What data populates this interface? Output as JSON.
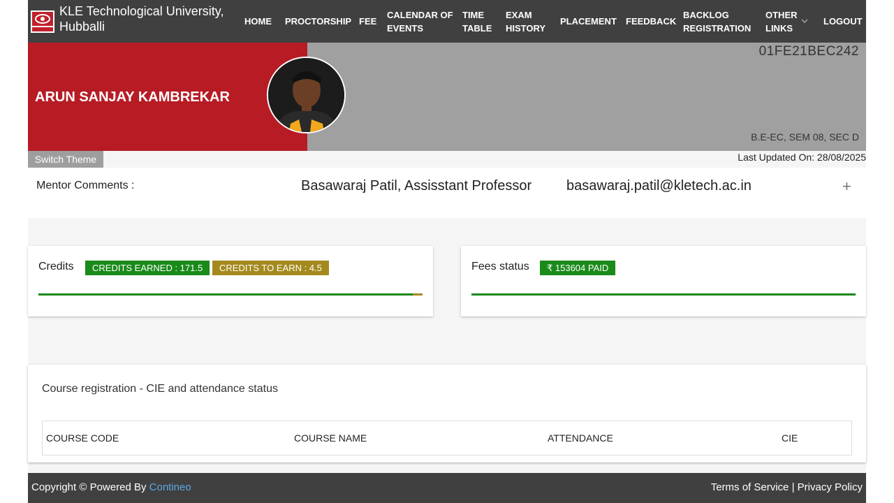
{
  "navbar": {
    "brand_line1": "KLE Technological University,",
    "brand_line2": "Hubballi",
    "logo_text": "KLE TECH",
    "items": [
      {
        "l1": "HOME",
        "l2": ""
      },
      {
        "l1": "PROCTORSHIP",
        "l2": ""
      },
      {
        "l1": "FEE",
        "l2": ""
      },
      {
        "l1": "CALENDAR OF",
        "l2": "EVENTS"
      },
      {
        "l1": "TIME",
        "l2": "TABLE"
      },
      {
        "l1": "EXAM",
        "l2": "HISTORY"
      },
      {
        "l1": "PLACEMENT",
        "l2": ""
      },
      {
        "l1": "FEEDBACK",
        "l2": ""
      },
      {
        "l1": "BACKLOG",
        "l2": "REGISTRATION"
      },
      {
        "l1": "OTHER",
        "l2": "LINKS"
      },
      {
        "l1": "LOGOUT",
        "l2": ""
      }
    ],
    "chevron_icon": "chevron-down-icon"
  },
  "profile": {
    "name": "ARUN SANJAY KAMBREKAR",
    "usn": "01FE21BEC242",
    "course_info": "B.E-EC, SEM 08, SEC D",
    "switch_theme": "Switch Theme",
    "last_updated": "Last Updated On: 28/08/2025"
  },
  "mentor": {
    "label": "Mentor Comments :",
    "name": "Basawaraj Patil, Assisstant Professor",
    "email": "basawaraj.patil@kletech.ac.in",
    "expand_icon": "+"
  },
  "credits": {
    "title": "Credits",
    "earned_label": "CREDITS EARNED : 171.5",
    "to_earn_label": "CREDITS TO EARN : 4.5",
    "earned": 171.5,
    "to_earn": 4.5,
    "earned_color": "#1a8a1a",
    "to_earn_color": "#a48a1e"
  },
  "fees": {
    "title": "Fees status",
    "badge": "₹ 153604 PAID",
    "paid_fraction": 1.0,
    "color": "#1a8a1a"
  },
  "courses": {
    "title": "Course registration - CIE and attendance status",
    "columns": [
      "COURSE CODE",
      "COURSE NAME",
      "ATTENDANCE",
      "CIE"
    ]
  },
  "footer": {
    "copyright": "Copyright © Powered By ",
    "powered_link": "Contineo",
    "terms": "Terms of Service",
    "separator": " | ",
    "privacy": "Privacy Policy"
  }
}
